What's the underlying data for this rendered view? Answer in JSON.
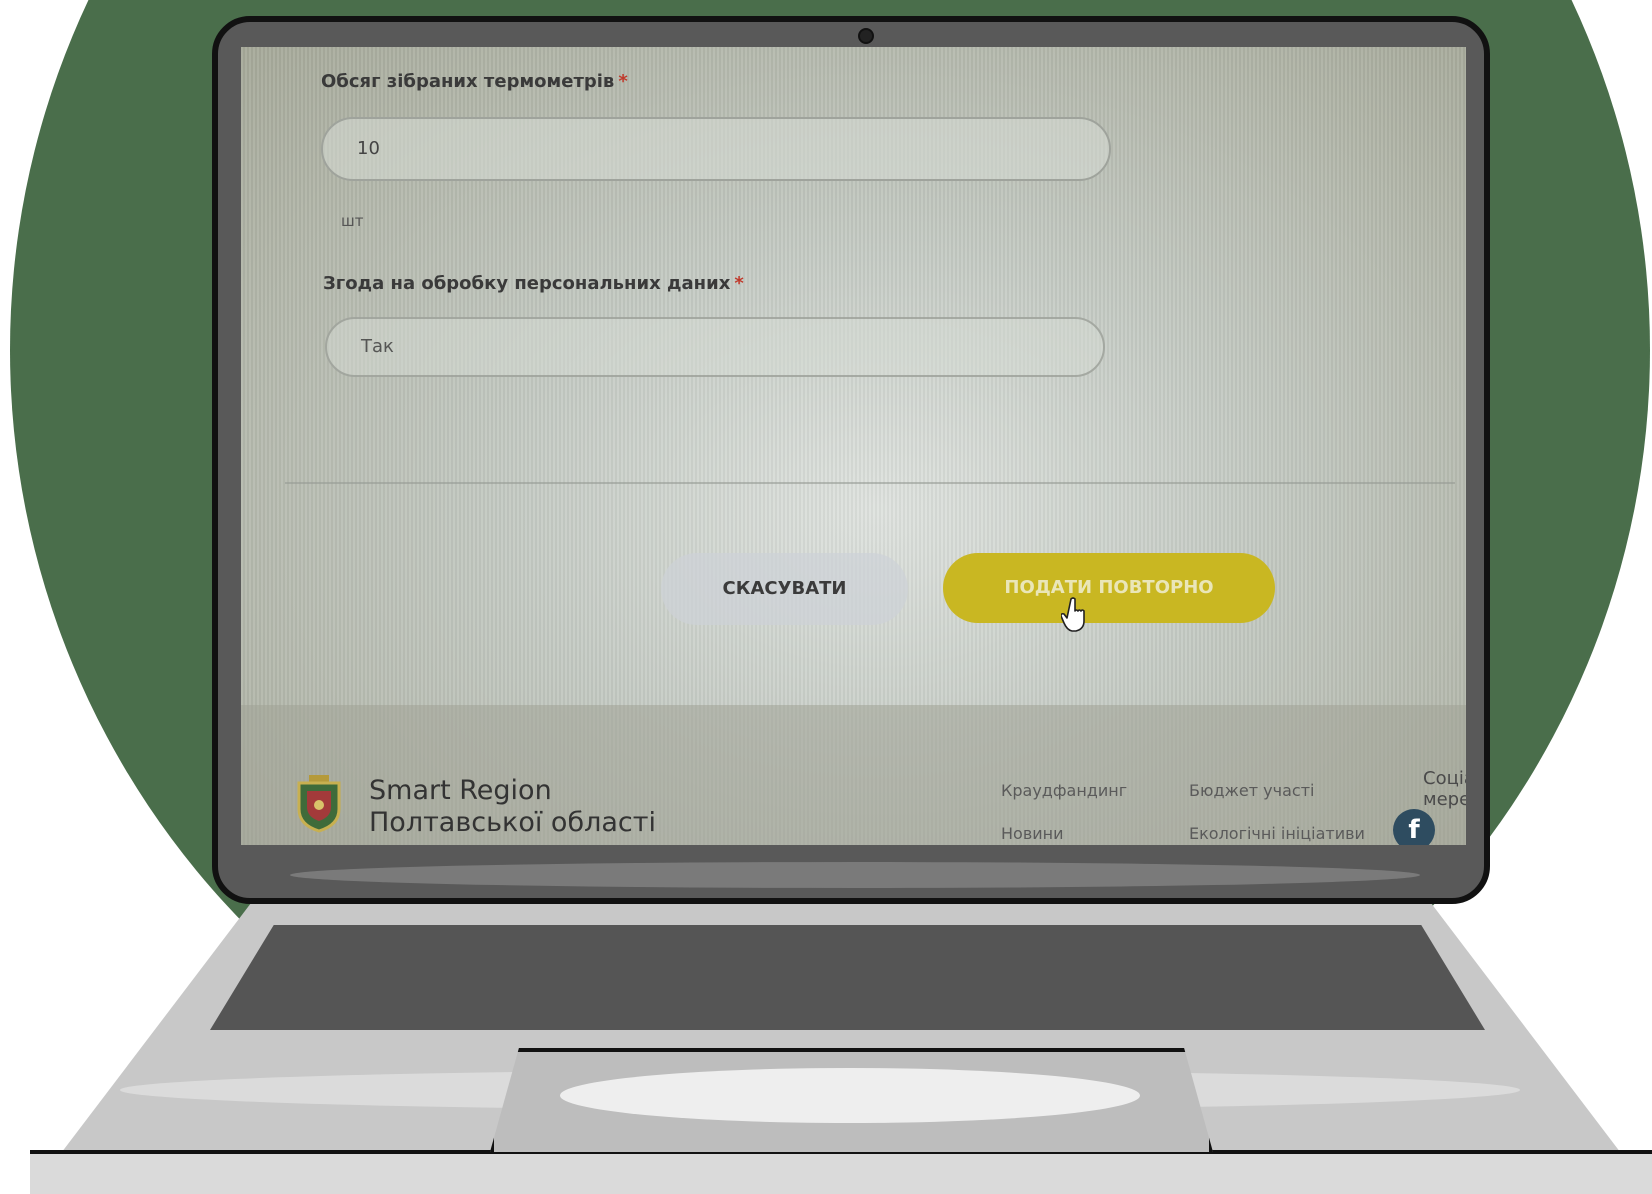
{
  "form": {
    "thermometers": {
      "label": "Обсяг зібраних термометрів",
      "required_mark": "*",
      "value": "10",
      "unit": "шт"
    },
    "consent": {
      "label": "Згода на обробку персональних даних",
      "required_mark": "*",
      "value": "Так"
    },
    "cancel_label": "СКАСУВАТИ",
    "resubmit_label": "ПОДАТИ ПОВТОРНО"
  },
  "footer": {
    "brand_line1": "Smart Region",
    "brand_line2": "Полтавської області",
    "links": {
      "crowdfunding": "Краудфандинг",
      "participation_budget": "Бюджет участі",
      "news": "Новини",
      "eco_initiatives": "Екологічні ініціативи"
    },
    "social_label": "Соціальні мережі",
    "facebook_glyph": "f"
  },
  "colors": {
    "background_circle": "#4a6e4b",
    "resubmit_button": "#c9b722",
    "facebook": "#2e4c60"
  },
  "icons": [
    "hand-pointer-icon",
    "coat-of-arms-icon",
    "facebook-icon",
    "camera-icon"
  ]
}
